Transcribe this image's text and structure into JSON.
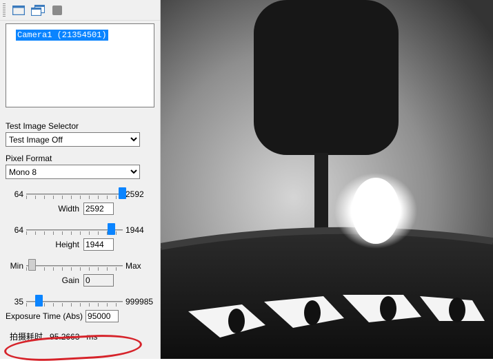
{
  "toolbar": {
    "icon1": "single-window-icon",
    "icon2": "multi-window-icon",
    "icon3": "stop-icon"
  },
  "camera_list": {
    "items": [
      {
        "label": "Camera1 (21354501)"
      }
    ]
  },
  "image_selector": {
    "label": "Test Image Selector",
    "selected": "Test Image Off"
  },
  "pixel_format": {
    "label": "Pixel Format",
    "selected": "Mono 8"
  },
  "width_slider": {
    "min_label": "64",
    "max_label": "2592",
    "field_label": "Width",
    "value": "2592",
    "thumb_pos": "96%"
  },
  "height_slider": {
    "min_label": "64",
    "max_label": "1944",
    "field_label": "Height",
    "value": "1944",
    "thumb_pos": "84%"
  },
  "gain_slider": {
    "min_label": "Min",
    "max_label": "Max",
    "field_label": "Gain",
    "value": "0",
    "thumb_pos": "2%"
  },
  "exposure_slider": {
    "min_label": "35",
    "max_label": "999985",
    "field_label": "Exposure Time (Abs)",
    "value": "95000",
    "thumb_pos": "9%"
  },
  "status": {
    "label": "拍摄耗时",
    "value": "95.2663",
    "unit": "ms"
  }
}
